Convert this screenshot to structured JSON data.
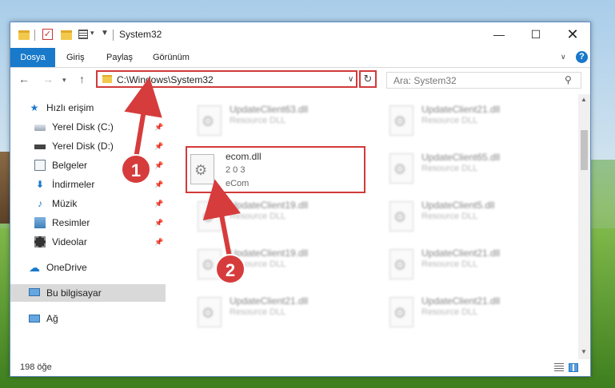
{
  "window": {
    "title": "System32",
    "min_glyph": "—",
    "max_glyph": "☐",
    "close_glyph": "✕"
  },
  "ribbon": {
    "file_tab": "Dosya",
    "tabs": [
      "Giriş",
      "Paylaş",
      "Görünüm"
    ],
    "help": "?"
  },
  "nav": {
    "back": "←",
    "forward": "→",
    "up": "↑",
    "address": "C:\\Windows\\System32",
    "refresh": "↻",
    "search_placeholder": "Ara: System32"
  },
  "sidebar": {
    "quick_access": "Hızlı erişim",
    "items": [
      {
        "label": "Yerel Disk (C:)"
      },
      {
        "label": "Yerel Disk (D:)"
      },
      {
        "label": "Belgeler"
      },
      {
        "label": "İndirmeler"
      },
      {
        "label": "Müzik"
      },
      {
        "label": "Resimler"
      },
      {
        "label": "Videolar"
      }
    ],
    "onedrive": "OneDrive",
    "this_pc": "Bu bilgisayar",
    "network": "Ağ"
  },
  "files": {
    "left": [
      {
        "name": "UpdateClient63.dll",
        "sub": "Resource DLL"
      },
      {
        "name": "UpdateClient19.dll",
        "sub": "Resource DLL"
      },
      {
        "name": "UpdateClient19.dll",
        "sub": "Resource DLL"
      },
      {
        "name": "UpdateClient21.dll",
        "sub": "Resource DLL"
      }
    ],
    "right": [
      {
        "name": "UpdateClient21.dll",
        "sub": "Resource DLL"
      },
      {
        "name": "UpdateClient65.dll",
        "sub": "Resource DLL"
      },
      {
        "name": "UpdateClient5.dll",
        "sub": "Resource DLL"
      },
      {
        "name": "UpdateClient21.dll",
        "sub": "Resource DLL"
      },
      {
        "name": "UpdateClient21.dll",
        "sub": "Resource DLL"
      }
    ],
    "highlighted": {
      "name": "ecom.dll",
      "version": "2 0 3",
      "desc": "eCom"
    }
  },
  "status": {
    "count": "198 öğe"
  },
  "badges": {
    "step1": "1",
    "step2": "2"
  },
  "colors": {
    "accent": "#1979ca",
    "highlight_red": "#d23a3a",
    "badge_red": "#d63c3c"
  }
}
